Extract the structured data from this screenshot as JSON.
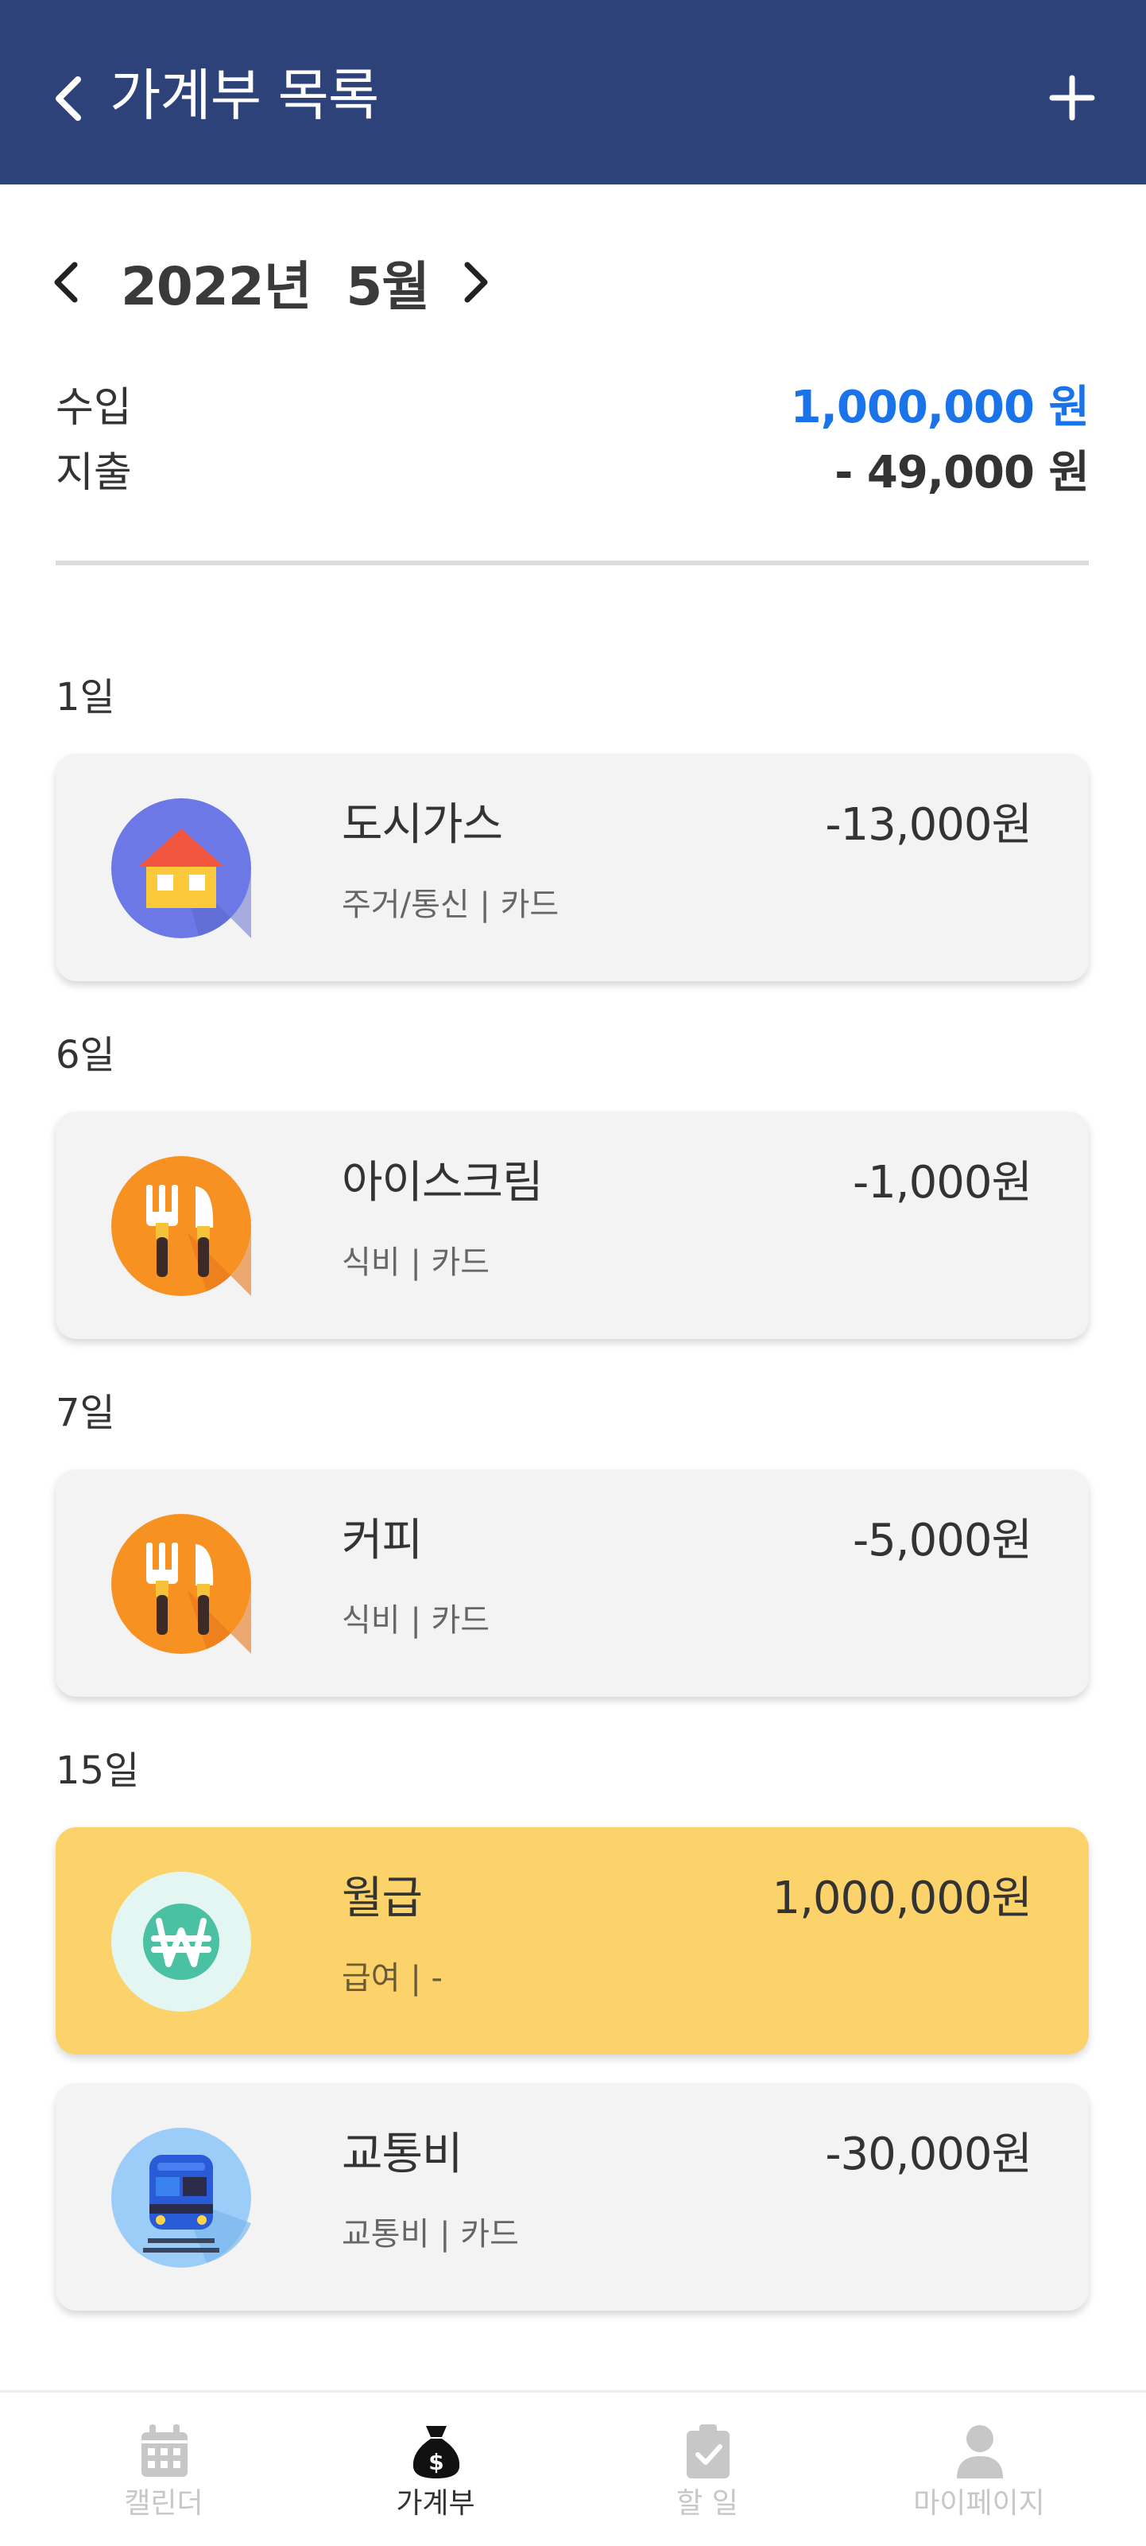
{
  "header": {
    "title": "가계부 목록",
    "back_icon": "chevron-left-icon",
    "add_icon": "plus-icon"
  },
  "month_nav": {
    "label": "2022년  5월",
    "prev_icon": "chevron-left-icon",
    "next_icon": "chevron-right-icon"
  },
  "summary": {
    "income_label": "수입",
    "income_value": "1,000,000 원",
    "expense_label": "지출",
    "expense_value": "- 49,000 원"
  },
  "colors": {
    "header_bg": "#2e427a",
    "income_color": "#1a73e8",
    "card_bg": "#f3f3f3",
    "highlight_card_bg": "#fcd36b"
  },
  "days": [
    {
      "label": "1일"
    },
    {
      "label": "6일"
    },
    {
      "label": "7일"
    },
    {
      "label": "15일"
    }
  ],
  "entries": [
    {
      "name": "도시가스",
      "sub": "주거/통신 | 카드",
      "amount": "-13,000원",
      "icon": "house-icon"
    },
    {
      "name": "아이스크림",
      "sub": "식비 | 카드",
      "amount": "-1,000원",
      "icon": "fork-knife-icon"
    },
    {
      "name": "커피",
      "sub": "식비 | 카드",
      "amount": "-5,000원",
      "icon": "fork-knife-icon"
    },
    {
      "name": "월급",
      "sub": "급여 | -",
      "amount": "1,000,000원",
      "icon": "won-coin-icon"
    },
    {
      "name": "교통비",
      "sub": "교통비 | 카드",
      "amount": "-30,000원",
      "icon": "train-icon"
    }
  ],
  "bottom_nav": [
    {
      "label": "캘린더",
      "icon": "calendar-icon"
    },
    {
      "label": "가계부",
      "icon": "money-bag-icon",
      "active": true
    },
    {
      "label": "할 일",
      "icon": "clipboard-check-icon"
    },
    {
      "label": "마이페이지",
      "icon": "person-icon"
    }
  ]
}
